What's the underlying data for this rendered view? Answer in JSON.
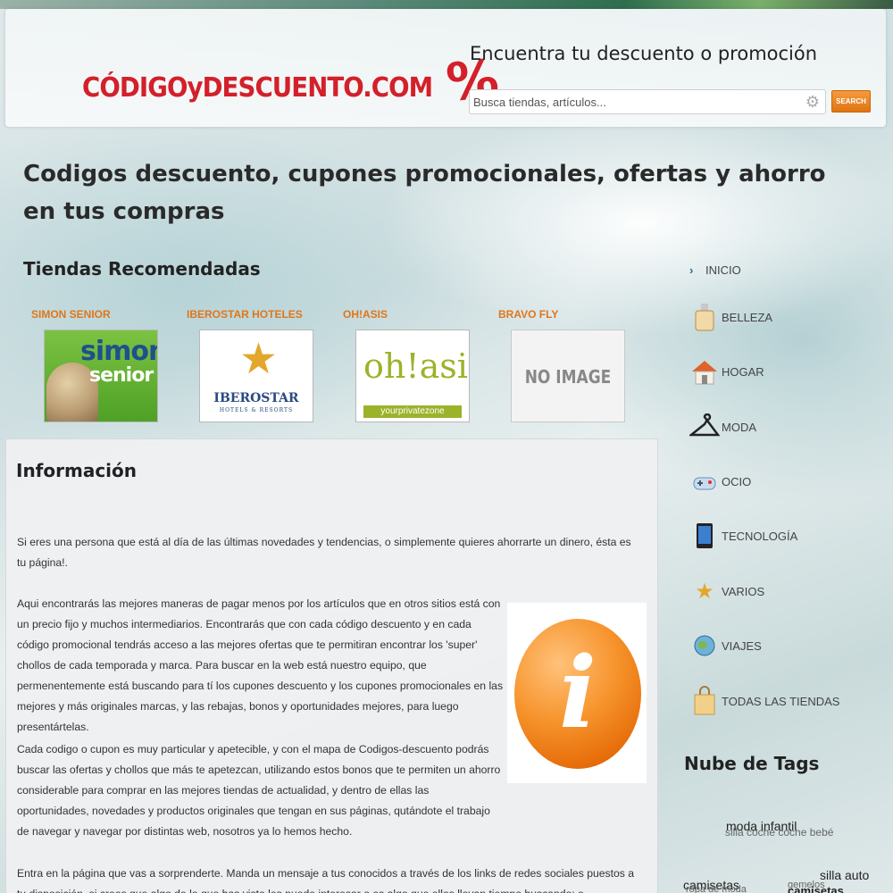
{
  "header": {
    "logo_text": "CÓDIGOyDESCUENTO.COM",
    "logo_percent": "%",
    "tagline": "Encuentra tu descuento o promoción",
    "search_placeholder": "Busca tiendas, artículos...",
    "search_button": "SEARCH"
  },
  "page_title": "Codigos descuento, cupones promocionales, ofertas y ahorro en tus compras",
  "recommended": {
    "title": "Tiendas Recomendadas",
    "stores": [
      {
        "name": "SIMON SENIOR",
        "logo_line1": "simon",
        "logo_line2": "senior"
      },
      {
        "name": "IBEROSTAR HOTELES",
        "logo_brand": "IBEROSTAR",
        "logo_sub": "HOTELS & RESORTS"
      },
      {
        "name": "OH!ASIS",
        "logo_main": "oh!asis",
        "logo_bar": "yourprivatezone"
      },
      {
        "name": "BRAVO FLY",
        "logo_placeholder": "NO IMAGE"
      }
    ]
  },
  "info": {
    "title": "Información",
    "paragraphs": [
      "Si eres una persona que está al día de las últimas novedades y tendencias, o simplemente quieres ahorrarte un dinero, ésta es tu página!.",
      "Aqui encontrarás las mejores maneras de pagar menos por los artículos que en otros sitios está con un precio fijo y muchos intermediarios. Encontrarás que con cada código descuento y en cada código promocional tendrás acceso a las mejores ofertas que te permitiran encontrar los 'super' chollos de cada temporada y marca. Para buscar en la web está nuestro equipo, que permenentemente está buscando para tí los cupones descuento y los cupones promocionales en las mejores y más originales marcas, y las rebajas, bonos y oportunidades mejores, para luego presentártelas.",
      "Cada codigo o cupon es muy particular y apetecible, y con el mapa de Codigos-descuento podrás buscar las ofertas y chollos que más te apetezcan, utilizando estos bonos que te permiten un ahorro considerable para comprar en las mejores tiendas de actualidad, y dentro de ellas las oportunidades, novedades y productos originales que tengan en sus páginas, qutándote el trabajo de navegar y navegar por distintas web, nosotros ya lo hemos hecho.",
      "Entra en la página que vas a sorprenderte. Manda un mensaje a tus conocidos a través de los links de redes sociales puestos a tu disposición, si crees que algo de lo que has visto les puede interesar o es algo que ellos llevan tiempo buscando; o simplemente"
    ],
    "info_icon_letter": "i"
  },
  "sidebar": {
    "items": [
      {
        "label": "INICIO",
        "icon": "chevron-right-icon"
      },
      {
        "label": "BELLEZA",
        "icon": "perfume-bottle-icon"
      },
      {
        "label": "HOGAR",
        "icon": "house-icon"
      },
      {
        "label": "MODA",
        "icon": "hanger-icon"
      },
      {
        "label": "OCIO",
        "icon": "gamepad-icon"
      },
      {
        "label": "TECNOLOGÍA",
        "icon": "tablet-icon"
      },
      {
        "label": "VARIOS",
        "icon": "stars-icon"
      },
      {
        "label": "VIAJES",
        "icon": "globe-icon"
      },
      {
        "label": "TODAS LAS TIENDAS",
        "icon": "shopping-bag-icon"
      }
    ]
  },
  "tags": {
    "title": "Nube de Tags",
    "items": [
      "moda infantil",
      "silla coche coche bebé",
      "camisetas",
      "silla auto",
      "gemelos",
      "camisetas",
      "ropa de moda"
    ]
  }
}
